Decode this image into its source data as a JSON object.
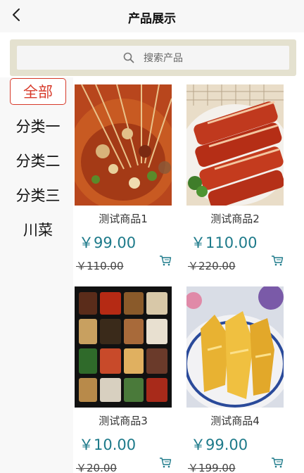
{
  "header": {
    "title": "产品展示"
  },
  "search": {
    "placeholder": "搜索产品"
  },
  "categories": [
    "全部",
    "分类一",
    "分类二",
    "分类三",
    "川菜"
  ],
  "products": [
    {
      "name": "测试商品1",
      "price": "￥99.00",
      "original_price": "￥110.00",
      "image": "skewer-hotpot"
    },
    {
      "name": "测试商品2",
      "price": "￥110.00",
      "original_price": "￥220.00",
      "image": "roast-pork"
    },
    {
      "name": "测试商品3",
      "price": "￥10.00",
      "original_price": "￥20.00",
      "image": "bento-box"
    },
    {
      "name": "测试商品4",
      "price": "￥99.00",
      "original_price": "￥199.00",
      "image": "boiled-chicken"
    }
  ],
  "colors": {
    "accent": "#d73a2a",
    "price": "#1d7a8a",
    "search_frame": "#e4e1cf"
  },
  "icons": {
    "back": "chevron-left-icon",
    "search": "search-icon",
    "cart": "cart-icon"
  }
}
